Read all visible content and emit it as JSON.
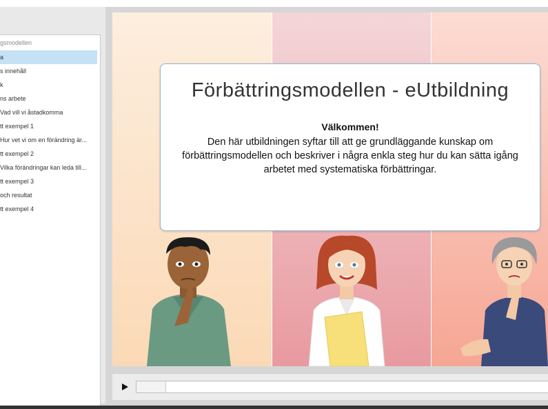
{
  "toc": {
    "header": "gsmodellen",
    "items": [
      {
        "label": "a",
        "active": true
      },
      {
        "label": "s innehåll",
        "active": false
      },
      {
        "label": "k",
        "active": false
      },
      {
        "label": "ns arbete",
        "active": false
      },
      {
        "label": " Vad vill vi åstadkomma",
        "active": false
      },
      {
        "label": "tt exempel 1",
        "active": false
      },
      {
        "label": " Hur vet vi om en förändring är...",
        "active": false
      },
      {
        "label": "tt exempel 2",
        "active": false
      },
      {
        "label": " Vilka förändringar kan leda till...",
        "active": false
      },
      {
        "label": "tt exempel 3",
        "active": false
      },
      {
        "label": "och resultat",
        "active": false
      },
      {
        "label": "tt exempel 4",
        "active": false
      }
    ]
  },
  "slide": {
    "title": "Förbättringsmodellen - eUtbildning",
    "welcome": "Välkommen!",
    "body": "Den här utbildningen syftar till att ge grundläggande kunskap om förbättringsmodellen och beskriver i några enkla steg hur du kan sätta igång arbetet med systematiska förbättringar."
  },
  "player": {
    "progress": 0.07,
    "play_icon": "play-icon"
  },
  "colors": {
    "active_toc": "#c4e2f3",
    "bubble_border": "#8cb8d8"
  }
}
